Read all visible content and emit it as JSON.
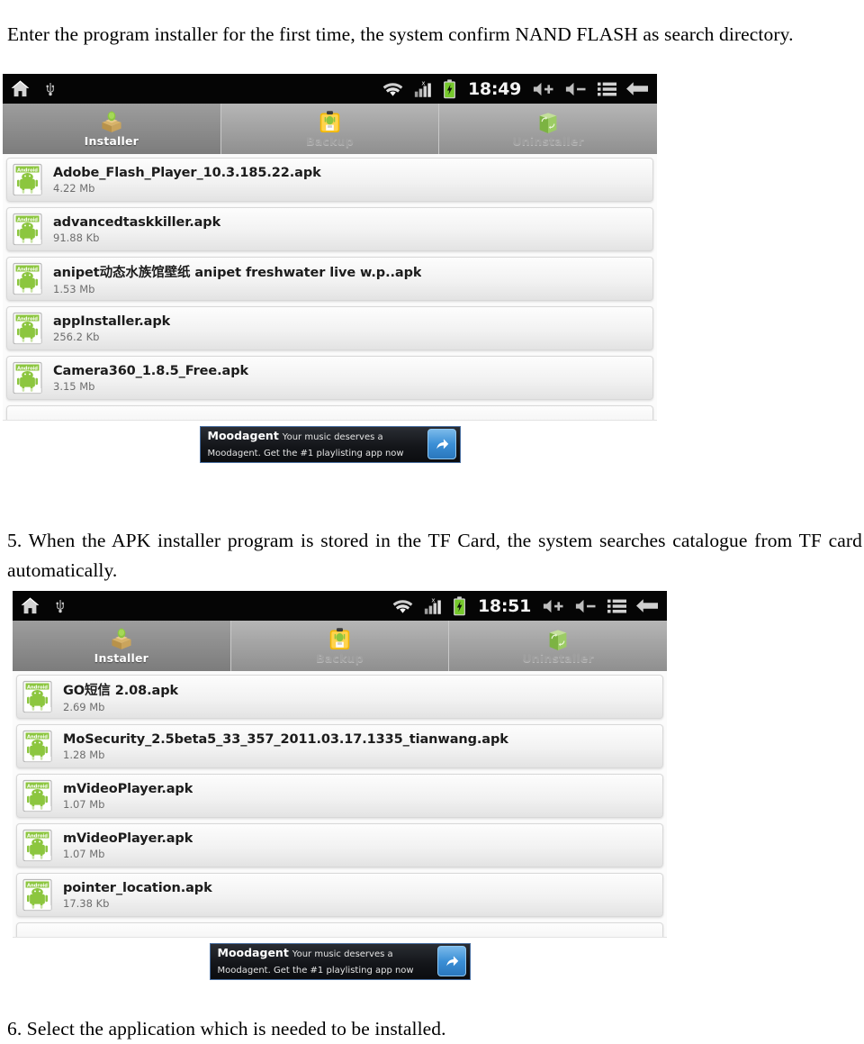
{
  "document": {
    "intro_paragraph": "Enter the program installer for the first time, the system confirm NAND FLASH as search directory.",
    "step5_paragraph": "5. When the APK installer program is stored in the TF Card, the system searches catalogue from TF card automatically.",
    "step6_paragraph": "6. Select the application which is needed to be installed."
  },
  "screenshot_1": {
    "statusbar": {
      "home_icon": "home-icon",
      "usb_icon": "usb-icon",
      "wifi_icon": "wifi-icon",
      "signal_icon": "signal-bars-icon",
      "battery_icon": "battery-charging-icon",
      "time": "18:49",
      "volume_up_icon": "volume-up-icon",
      "volume_down_icon": "volume-down-icon",
      "menu_icon": "menu-icon",
      "back_icon": "back-arrow-icon"
    },
    "tabs": [
      {
        "label": "Installer",
        "icon": "installer-box-icon",
        "active": true
      },
      {
        "label": "Backup",
        "icon": "backup-clipboard-icon",
        "active": false
      },
      {
        "label": "Uninstaller",
        "icon": "uninstaller-bin-icon",
        "active": false
      }
    ],
    "apps": [
      {
        "name": "Adobe_Flash_Player_10.3.185.22.apk",
        "size": "4.22 Mb"
      },
      {
        "name": "advancedtaskkiller.apk",
        "size": "91.88 Kb"
      },
      {
        "name": "anipet动态水族馆壁纸 anipet freshwater live  w.p..apk",
        "size": "1.53 Mb"
      },
      {
        "name": "appInstaller.apk",
        "size": "256.2 Kb"
      },
      {
        "name": "Camera360_1.8.5_Free.apk",
        "size": "3.15 Mb"
      }
    ],
    "ad": {
      "title": "Moodagent",
      "line1": "Your music deserves a",
      "line2": "Moodagent. Get the #1 playlisting app now",
      "cta_icon": "share-arrow-icon"
    }
  },
  "screenshot_2": {
    "statusbar": {
      "home_icon": "home-icon",
      "usb_icon": "usb-icon",
      "wifi_icon": "wifi-icon",
      "signal_icon": "signal-bars-icon",
      "battery_icon": "battery-charging-icon",
      "time": "18:51",
      "volume_up_icon": "volume-up-icon",
      "volume_down_icon": "volume-down-icon",
      "menu_icon": "menu-icon",
      "back_icon": "back-arrow-icon"
    },
    "tabs": [
      {
        "label": "Installer",
        "icon": "installer-box-icon",
        "active": true
      },
      {
        "label": "Backup",
        "icon": "backup-clipboard-icon",
        "active": false
      },
      {
        "label": "Uninstaller",
        "icon": "uninstaller-bin-icon",
        "active": false
      }
    ],
    "apps": [
      {
        "name": "GO短信 2.08.apk",
        "size": "2.69 Mb"
      },
      {
        "name": "MoSecurity_2.5beta5_33_357_2011.03.17.1335_tianwang.apk",
        "size": "1.28 Mb"
      },
      {
        "name": "mVideoPlayer.apk",
        "size": "1.07 Mb"
      },
      {
        "name": "mVideoPlayer.apk",
        "size": "1.07 Mb"
      },
      {
        "name": "pointer_location.apk",
        "size": "17.38 Kb"
      }
    ],
    "ad": {
      "title": "Moodagent",
      "line1": "Your music deserves a",
      "line2": "Moodagent. Get the #1 playlisting app now",
      "cta_icon": "share-arrow-icon"
    }
  },
  "colors": {
    "statusbar_bg": "#050505",
    "tabbar_bg": "#a2a2a2",
    "active_tab_bg": "#8b8b8b",
    "android_green": "#8cc63f",
    "ad_bg": "#14161a",
    "ad_cta_blue": "#3b8fd6"
  }
}
